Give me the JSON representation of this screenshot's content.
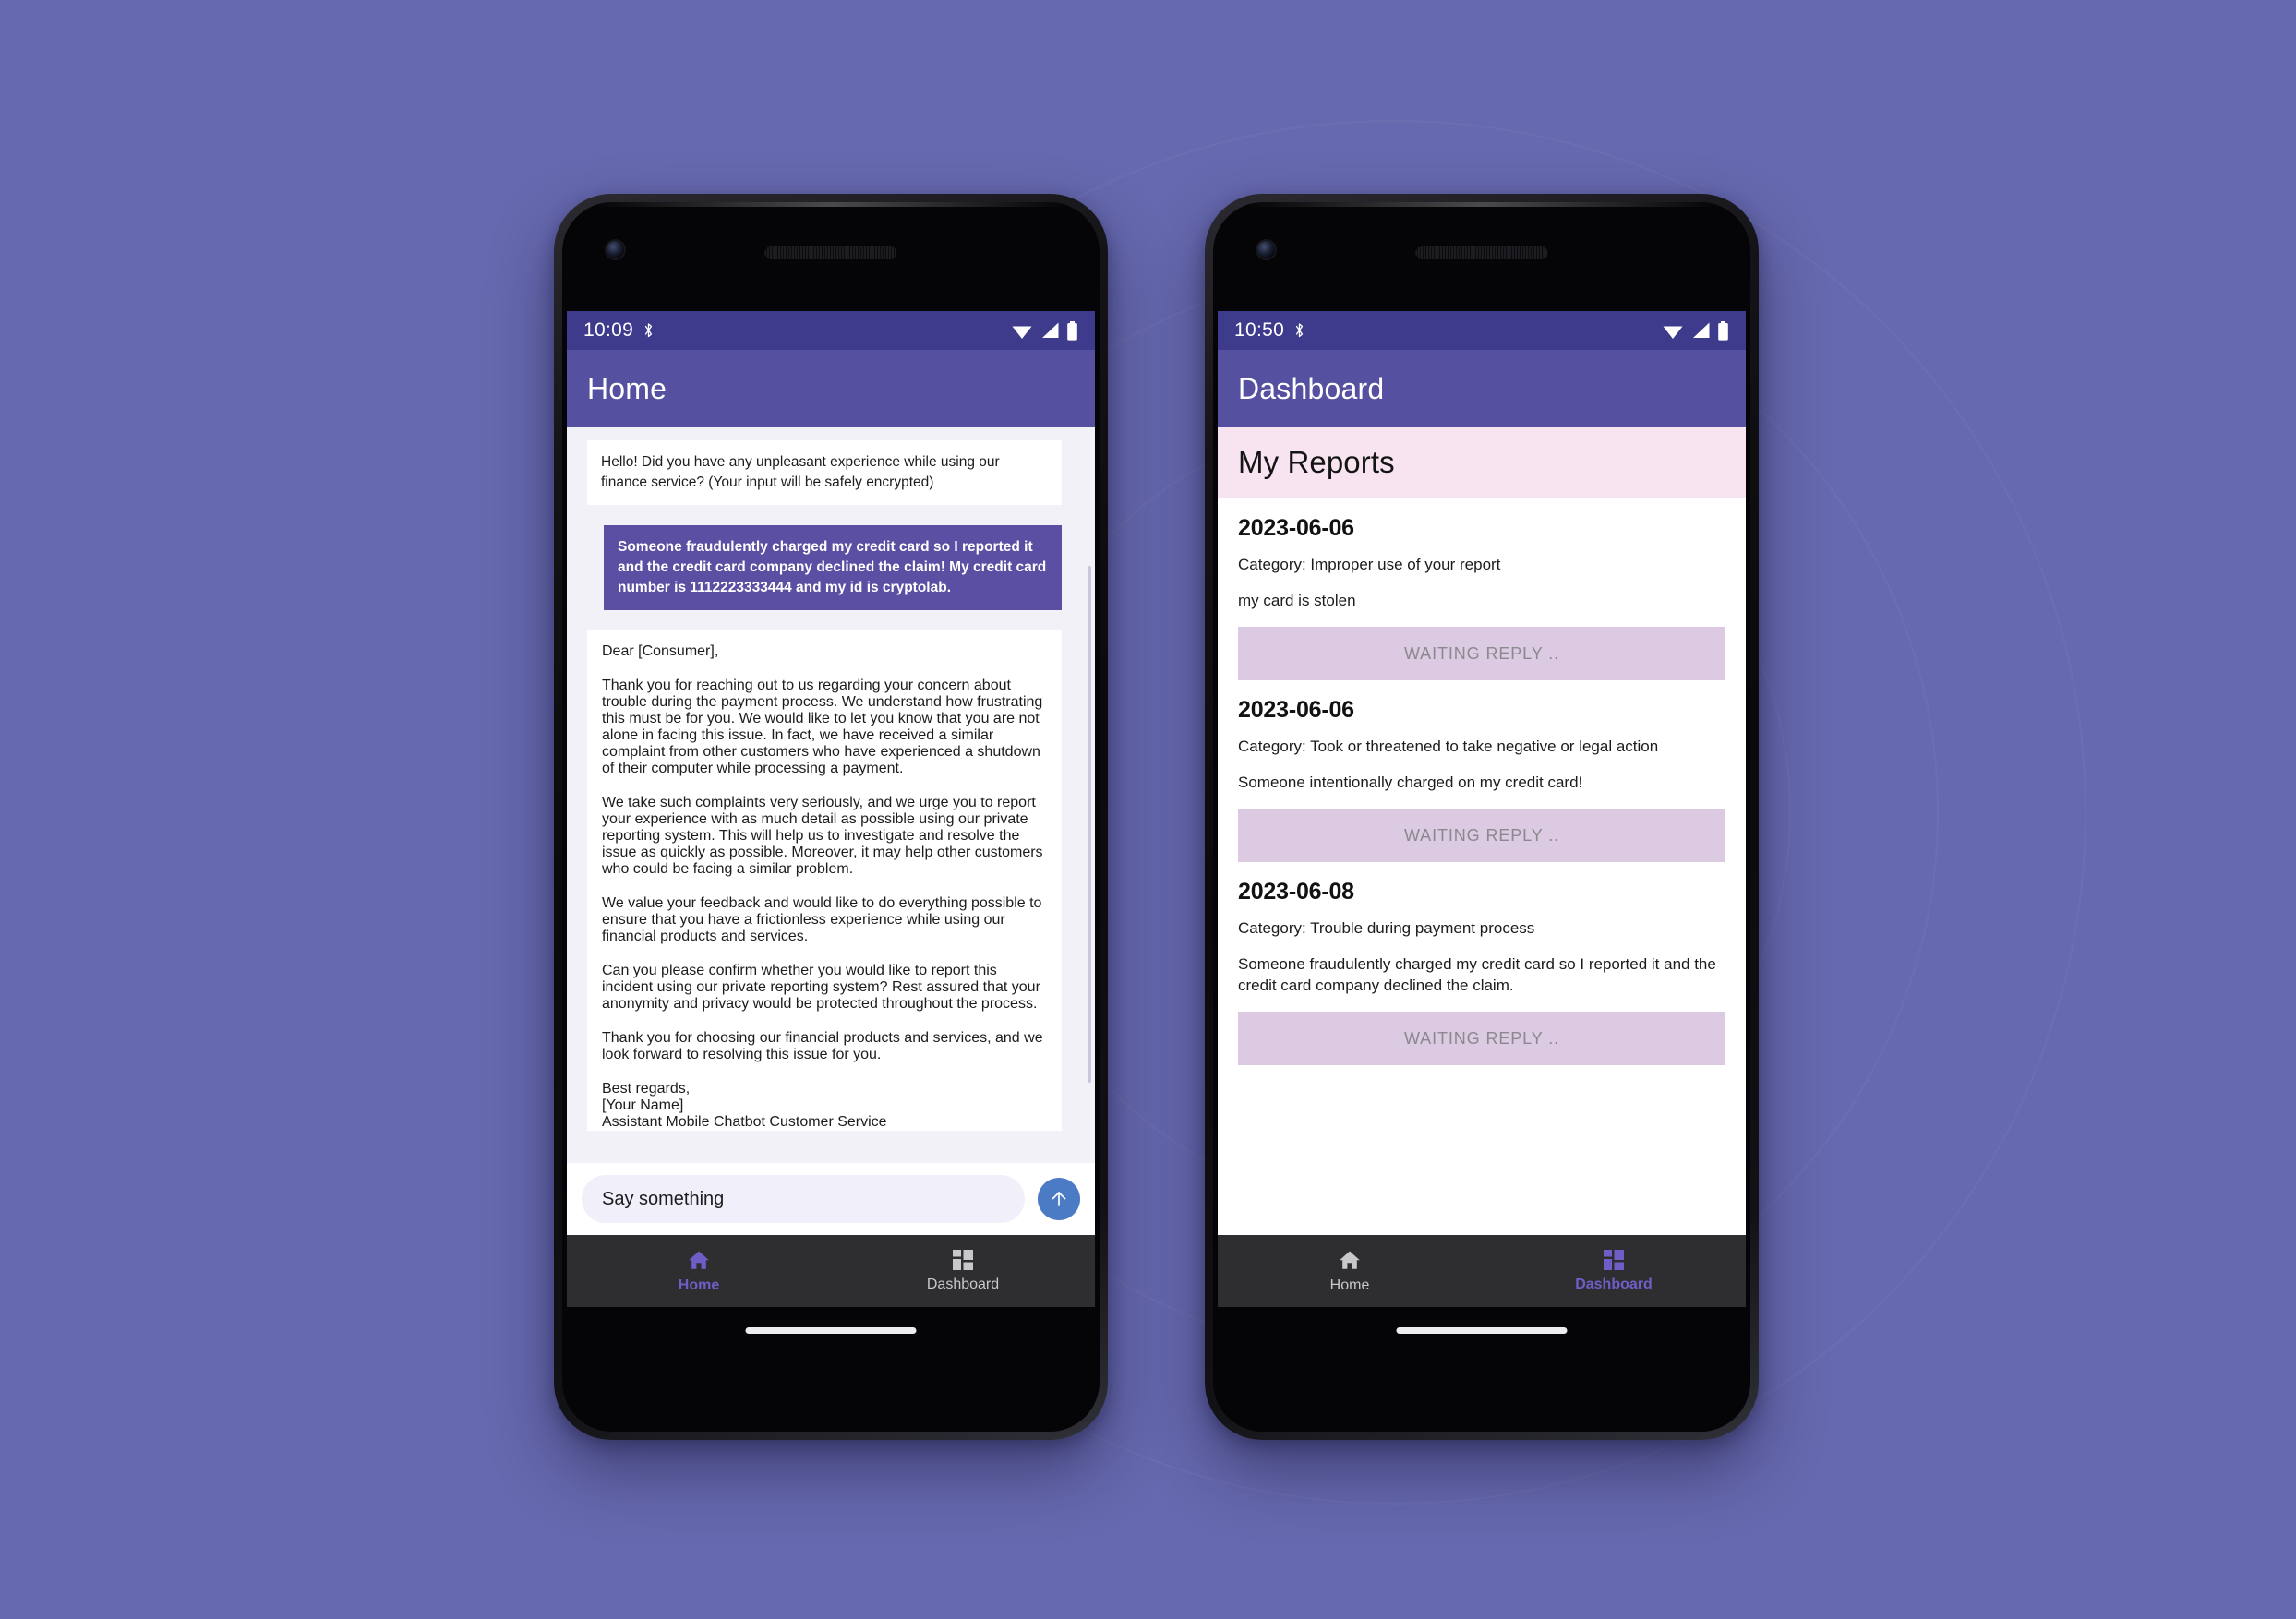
{
  "theme": {
    "backdrop": "#6669AF",
    "status_bar": "#3E3A8C",
    "app_bar": "#5650A0",
    "chat_background": "#F2F1F8",
    "user_bubble": "#5A4FA3",
    "dash_header_band": "#F7E4F0",
    "waiting_button": "#DCC9E2",
    "send_button": "#4A7BC4",
    "nav_bar": "#2E2E31",
    "nav_active": "#6F5EC7"
  },
  "phone_left": {
    "status": {
      "time": "10:09",
      "bluetooth_icon": "bluetooth-icon",
      "wifi_icon": "wifi-icon",
      "signal_icon": "signal-icon",
      "battery_icon": "battery-icon"
    },
    "app_bar": {
      "title": "Home"
    },
    "chat": {
      "messages": [
        {
          "sender": "bot",
          "text": "Hello! Did you have any unpleasant experience while using our finance service? (Your input will be safely encrypted)"
        },
        {
          "sender": "user",
          "text": "Someone fraudulently charged my credit card so I reported it and the credit card company declined the claim! My credit card number is 1112223333444 and my id is cryptolab."
        }
      ],
      "reply": {
        "greeting": "Dear [Consumer],",
        "paragraphs": [
          "Thank you for reaching out to us regarding your concern about trouble during the payment process. We understand how frustrating this must be for you. We would like to let you know that you are not alone in facing this issue. In fact, we have received a similar complaint from other customers who have experienced a shutdown of their computer while processing a payment.",
          "We take such complaints very seriously, and we urge you to report your experience with as much detail as possible using our private reporting system. This will help us to investigate and resolve the issue as quickly as possible. Moreover, it may help other customers who could be facing a similar problem.",
          "We value your feedback and would like to do everything possible to ensure that you have a frictionless experience while using our financial products and services.",
          "Can you please confirm whether you would like to report this incident using our private reporting system? Rest assured that your anonymity and privacy would be protected throughout the process.",
          "Thank you for choosing our financial products and services, and we look forward to resolving this issue for you."
        ],
        "signature": [
          "Best regards,",
          "[Your Name]",
          "Assistant Mobile Chatbot Customer Service"
        ]
      }
    },
    "composer": {
      "placeholder": "Say something",
      "value": "",
      "send_icon": "send-arrow-up-icon"
    },
    "bottom_nav": {
      "active": "Home",
      "items": [
        {
          "label": "Home",
          "icon": "home-icon",
          "active": true
        },
        {
          "label": "Dashboard",
          "icon": "dashboard-grid-icon",
          "active": false
        }
      ]
    }
  },
  "phone_right": {
    "status": {
      "time": "10:50",
      "bluetooth_icon": "bluetooth-icon",
      "wifi_icon": "wifi-icon",
      "signal_icon": "signal-icon",
      "battery_icon": "battery-icon"
    },
    "app_bar": {
      "title": "Dashboard"
    },
    "dashboard": {
      "section_title": "My Reports",
      "reports": [
        {
          "date": "2023-06-06",
          "category": "Category: Improper use of your report",
          "description": "my card is stolen",
          "status_label": "WAITING REPLY .."
        },
        {
          "date": "2023-06-06",
          "category": "Category: Took or threatened to take negative or legal action",
          "description": "Someone intentionally charged on my credit card!",
          "status_label": "WAITING REPLY .."
        },
        {
          "date": "2023-06-08",
          "category": "Category: Trouble during payment process",
          "description": "Someone fraudulently charged my credit card so I reported it and the credit card company declined the claim.",
          "status_label": "WAITING REPLY .."
        }
      ]
    },
    "bottom_nav": {
      "active": "Dashboard",
      "items": [
        {
          "label": "Home",
          "icon": "home-icon",
          "active": false
        },
        {
          "label": "Dashboard",
          "icon": "dashboard-grid-icon",
          "active": true
        }
      ]
    }
  }
}
